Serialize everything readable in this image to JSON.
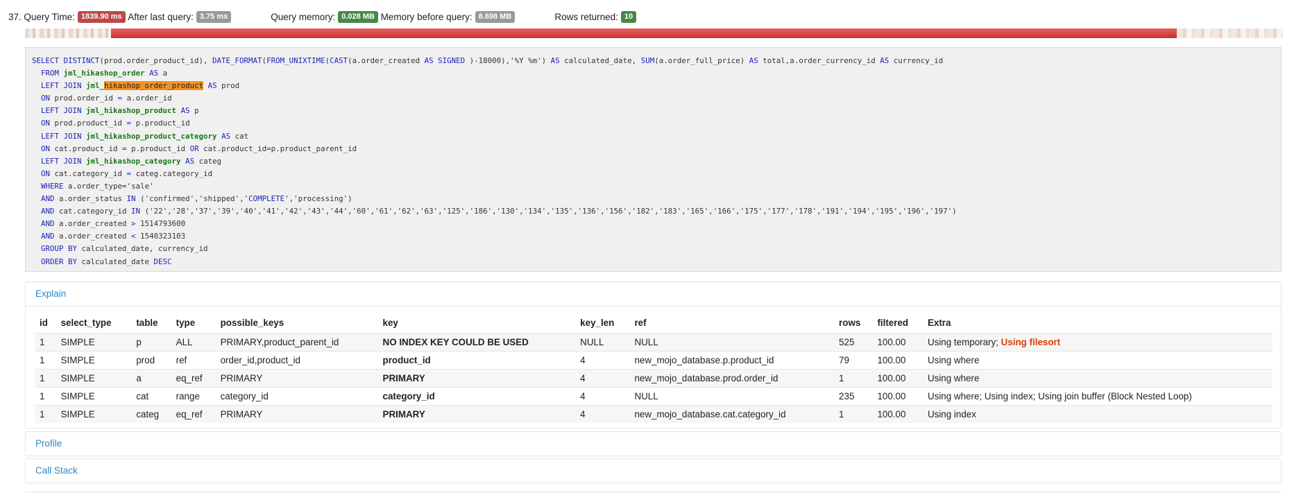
{
  "query_index": "37.",
  "query_time_label": "Query Time:",
  "query_time_value": "1839.90 ms",
  "after_last_label": "After last query:",
  "after_last_value": "3.75 ms",
  "query_memory_label": "Query memory:",
  "query_memory_value": "0.028 MB",
  "memory_before_label": "Memory before query:",
  "memory_before_value": "8.698 MB",
  "rows_returned_label": "Rows returned:",
  "rows_returned_value": "10",
  "colors": {
    "danger": "#b94a48",
    "muted": "#999999",
    "success": "#468847",
    "keyword": "#1d21b8",
    "table": "#197719",
    "highlight": "#f39223",
    "warning": "#e23b00",
    "link": "#2a87c8"
  },
  "sql_lines": [
    [
      {
        "t": "SELECT DISTINCT",
        "c": "kw"
      },
      {
        "t": "(prod.order_product_id), ",
        "c": ""
      },
      {
        "t": "DATE_FORMAT",
        "c": "kw"
      },
      {
        "t": "(",
        "c": ""
      },
      {
        "t": "FROM_UNIXTIME",
        "c": "kw"
      },
      {
        "t": "(",
        "c": ""
      },
      {
        "t": "CAST",
        "c": "kw"
      },
      {
        "t": "(a.order_created ",
        "c": ""
      },
      {
        "t": "AS SIGNED",
        "c": "kw"
      },
      {
        "t": " )-18000),'%Y %m') ",
        "c": ""
      },
      {
        "t": "AS",
        "c": "kw"
      },
      {
        "t": " calculated_date, ",
        "c": ""
      },
      {
        "t": "SUM",
        "c": "kw"
      },
      {
        "t": "(a.order_full_price) ",
        "c": ""
      },
      {
        "t": "AS",
        "c": "kw"
      },
      {
        "t": " total,a.order_currency_id ",
        "c": ""
      },
      {
        "t": "AS",
        "c": "kw"
      },
      {
        "t": " currency_id",
        "c": ""
      }
    ],
    [
      {
        "t": "  ",
        "c": ""
      },
      {
        "t": "FROM",
        "c": "kw"
      },
      {
        "t": " ",
        "c": ""
      },
      {
        "t": "jml_hikashop_order",
        "c": "tb"
      },
      {
        "t": " ",
        "c": ""
      },
      {
        "t": "AS",
        "c": "kw"
      },
      {
        "t": " a",
        "c": ""
      }
    ],
    [
      {
        "t": "  ",
        "c": ""
      },
      {
        "t": "LEFT JOIN",
        "c": "kw"
      },
      {
        "t": " ",
        "c": ""
      },
      {
        "t": "jml_",
        "c": "tb"
      },
      {
        "t": "hikashop_order_product",
        "c": "hl"
      },
      {
        "t": " ",
        "c": ""
      },
      {
        "t": "AS",
        "c": "kw"
      },
      {
        "t": " prod",
        "c": ""
      }
    ],
    [
      {
        "t": "  ",
        "c": ""
      },
      {
        "t": "ON",
        "c": "kw"
      },
      {
        "t": " prod.order_id ",
        "c": ""
      },
      {
        "t": "=",
        "c": "kw"
      },
      {
        "t": " a.order_id",
        "c": ""
      }
    ],
    [
      {
        "t": "  ",
        "c": ""
      },
      {
        "t": "LEFT JOIN",
        "c": "kw"
      },
      {
        "t": " ",
        "c": ""
      },
      {
        "t": "jml_hikashop_product",
        "c": "tb"
      },
      {
        "t": " ",
        "c": ""
      },
      {
        "t": "AS",
        "c": "kw"
      },
      {
        "t": " p",
        "c": ""
      }
    ],
    [
      {
        "t": "  ",
        "c": ""
      },
      {
        "t": "ON",
        "c": "kw"
      },
      {
        "t": " prod.product_id ",
        "c": ""
      },
      {
        "t": "=",
        "c": "kw"
      },
      {
        "t": " p.product_id",
        "c": ""
      }
    ],
    [
      {
        "t": "  ",
        "c": ""
      },
      {
        "t": "LEFT JOIN",
        "c": "kw"
      },
      {
        "t": " ",
        "c": ""
      },
      {
        "t": "jml_hikashop_product_category",
        "c": "tb"
      },
      {
        "t": " ",
        "c": ""
      },
      {
        "t": "AS",
        "c": "kw"
      },
      {
        "t": " cat",
        "c": ""
      }
    ],
    [
      {
        "t": "  ",
        "c": ""
      },
      {
        "t": "ON",
        "c": "kw"
      },
      {
        "t": " cat.product_id ",
        "c": ""
      },
      {
        "t": "=",
        "c": "kw"
      },
      {
        "t": " p.product_id ",
        "c": ""
      },
      {
        "t": "OR",
        "c": "kw"
      },
      {
        "t": " cat.product_id",
        "c": ""
      },
      {
        "t": "=",
        "c": "kw"
      },
      {
        "t": "p.product_parent_id",
        "c": ""
      }
    ],
    [
      {
        "t": "  ",
        "c": ""
      },
      {
        "t": "LEFT JOIN",
        "c": "kw"
      },
      {
        "t": " ",
        "c": ""
      },
      {
        "t": "jml_hikashop_category",
        "c": "tb"
      },
      {
        "t": " ",
        "c": ""
      },
      {
        "t": "AS",
        "c": "kw"
      },
      {
        "t": " categ",
        "c": ""
      }
    ],
    [
      {
        "t": "  ",
        "c": ""
      },
      {
        "t": "ON",
        "c": "kw"
      },
      {
        "t": " cat.category_id ",
        "c": ""
      },
      {
        "t": "=",
        "c": "kw"
      },
      {
        "t": " categ.category_id",
        "c": ""
      }
    ],
    [
      {
        "t": "  ",
        "c": ""
      },
      {
        "t": "WHERE",
        "c": "kw"
      },
      {
        "t": " a.order_type",
        "c": ""
      },
      {
        "t": "=",
        "c": "kw"
      },
      {
        "t": "'sale'",
        "c": ""
      }
    ],
    [
      {
        "t": "  ",
        "c": ""
      },
      {
        "t": "AND",
        "c": "kw"
      },
      {
        "t": " a.order_status ",
        "c": ""
      },
      {
        "t": "IN",
        "c": "kw"
      },
      {
        "t": " ('confirmed','shipped','",
        "c": ""
      },
      {
        "t": "COMPLETE",
        "c": "kw"
      },
      {
        "t": "','processing')",
        "c": ""
      }
    ],
    [
      {
        "t": "  ",
        "c": ""
      },
      {
        "t": "AND",
        "c": "kw"
      },
      {
        "t": " cat.category_id ",
        "c": ""
      },
      {
        "t": "IN",
        "c": "kw"
      },
      {
        "t": " ('22','28','37','39','40','41','42','43','44','60','61','62','63','125','186','130','134','135','136','156','182','183','165','166','175','177','178','191','194','195','196','197')",
        "c": ""
      }
    ],
    [
      {
        "t": "  ",
        "c": ""
      },
      {
        "t": "AND",
        "c": "kw"
      },
      {
        "t": " a.order_created ",
        "c": ""
      },
      {
        "t": ">",
        "c": "kw"
      },
      {
        "t": " 1514793600",
        "c": ""
      }
    ],
    [
      {
        "t": "  ",
        "c": ""
      },
      {
        "t": "AND",
        "c": "kw"
      },
      {
        "t": " a.order_created ",
        "c": ""
      },
      {
        "t": "<",
        "c": "kw"
      },
      {
        "t": " 1540323103",
        "c": ""
      }
    ],
    [
      {
        "t": "  ",
        "c": ""
      },
      {
        "t": "GROUP BY",
        "c": "kw"
      },
      {
        "t": " calculated_date, currency_id",
        "c": ""
      }
    ],
    [
      {
        "t": "  ",
        "c": ""
      },
      {
        "t": "ORDER BY",
        "c": "kw"
      },
      {
        "t": " calculated_date ",
        "c": ""
      },
      {
        "t": "DESC",
        "c": "kw"
      }
    ]
  ],
  "explain": {
    "title": "Explain",
    "headers": [
      "id",
      "select_type",
      "table",
      "type",
      "possible_keys",
      "key",
      "key_len",
      "ref",
      "rows",
      "filtered",
      "Extra"
    ],
    "rows": [
      {
        "id": "1",
        "select_type": "SIMPLE",
        "table": "p",
        "type": "ALL",
        "possible_keys": "PRIMARY,product_parent_id",
        "key": "NO INDEX KEY COULD BE USED",
        "key_warn": true,
        "key_len": "NULL",
        "ref": "NULL",
        "rows": "525",
        "filtered": "100.00",
        "extra": "Using temporary; ",
        "extra_warn": "Using filesort"
      },
      {
        "id": "1",
        "select_type": "SIMPLE",
        "table": "prod",
        "type": "ref",
        "possible_keys": "order_id,product_id",
        "key": "product_id",
        "key_warn": false,
        "key_len": "4",
        "ref": "new_mojo_database.p.product_id",
        "rows": "79",
        "filtered": "100.00",
        "extra": "Using where",
        "extra_warn": ""
      },
      {
        "id": "1",
        "select_type": "SIMPLE",
        "table": "a",
        "type": "eq_ref",
        "possible_keys": "PRIMARY",
        "key": "PRIMARY",
        "key_warn": false,
        "key_len": "4",
        "ref": "new_mojo_database.prod.order_id",
        "rows": "1",
        "filtered": "100.00",
        "extra": "Using where",
        "extra_warn": ""
      },
      {
        "id": "1",
        "select_type": "SIMPLE",
        "table": "cat",
        "type": "range",
        "possible_keys": "category_id",
        "key": "category_id",
        "key_warn": false,
        "key_len": "4",
        "ref": "NULL",
        "rows": "235",
        "filtered": "100.00",
        "extra": "Using where; Using index; Using join buffer (Block Nested Loop)",
        "extra_warn": ""
      },
      {
        "id": "1",
        "select_type": "SIMPLE",
        "table": "categ",
        "type": "eq_ref",
        "possible_keys": "PRIMARY",
        "key": "PRIMARY",
        "key_warn": false,
        "key_len": "4",
        "ref": "new_mojo_database.cat.category_id",
        "rows": "1",
        "filtered": "100.00",
        "extra": "Using index",
        "extra_warn": ""
      }
    ]
  },
  "profile_title": "Profile",
  "callstack_title": "Call Stack"
}
